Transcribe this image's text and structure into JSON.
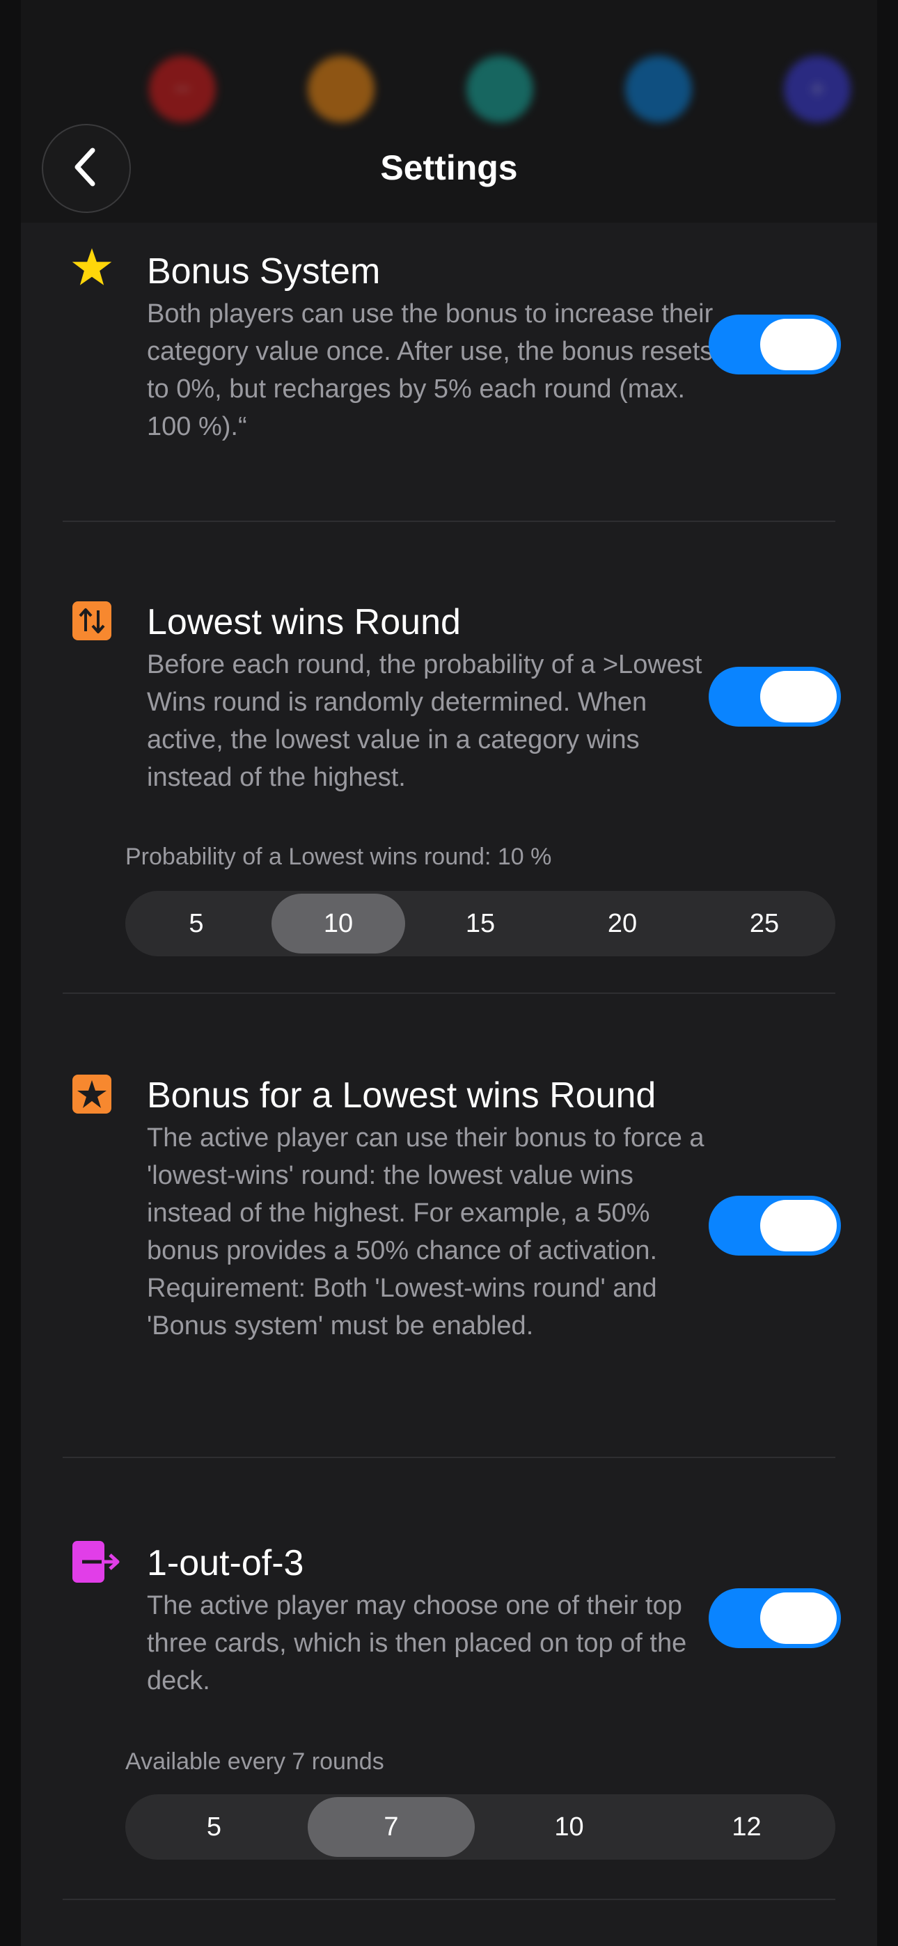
{
  "header": {
    "title": "Settings",
    "back_icon": "chevron-left-icon",
    "background_dots": [
      {
        "color": "#d81b1b",
        "glyph": "−"
      },
      {
        "color": "#f08a12",
        "glyph": ""
      },
      {
        "color": "#18a89c",
        "glyph": ""
      },
      {
        "color": "#0a7fd6",
        "glyph": ""
      },
      {
        "color": "#3b3bd9",
        "glyph": "+"
      }
    ]
  },
  "colors": {
    "accent": "#0a84ff",
    "background": "#1c1c1e",
    "star": "#ffd60a",
    "orange": "#f7882f",
    "magenta": "#e13ee8"
  },
  "settings": [
    {
      "icon": "star-icon",
      "title": "Bonus System",
      "description": "Both players can use the bonus to increase their category value once. After use, the bonus resets to 0%, but recharges by 5% each round (max. 100 %).“",
      "enabled": true
    },
    {
      "icon": "arrows-up-down-icon",
      "title": "Lowest wins Round",
      "description": "Before each round, the probability of a >Lowest Wins round is randomly determined. When active, the lowest value in a category wins instead of the highest.",
      "enabled": true,
      "picker_label": "Probability of a Lowest wins round: 10 %",
      "options": [
        "5",
        "10",
        "15",
        "20",
        "25"
      ],
      "selected": "10"
    },
    {
      "icon": "star-square-icon",
      "title": "Bonus for a Lowest wins Round",
      "description": "The active player can use their bonus to force a 'lowest-wins' round: the lowest value wins instead of the highest. For example, a 50% bonus provides a 50% chance of activation. Requirement: Both 'Lowest-wins round' and 'Bonus system' must be enabled.",
      "enabled": true
    },
    {
      "icon": "card-arrow-right-icon",
      "title": "1-out-of-3",
      "description": "The active player may choose one of their top three cards, which is then placed on top of the deck.",
      "enabled": true,
      "picker_label": "Available every 7 rounds",
      "options": [
        "5",
        "7",
        "10",
        "12"
      ],
      "selected": "7"
    }
  ]
}
